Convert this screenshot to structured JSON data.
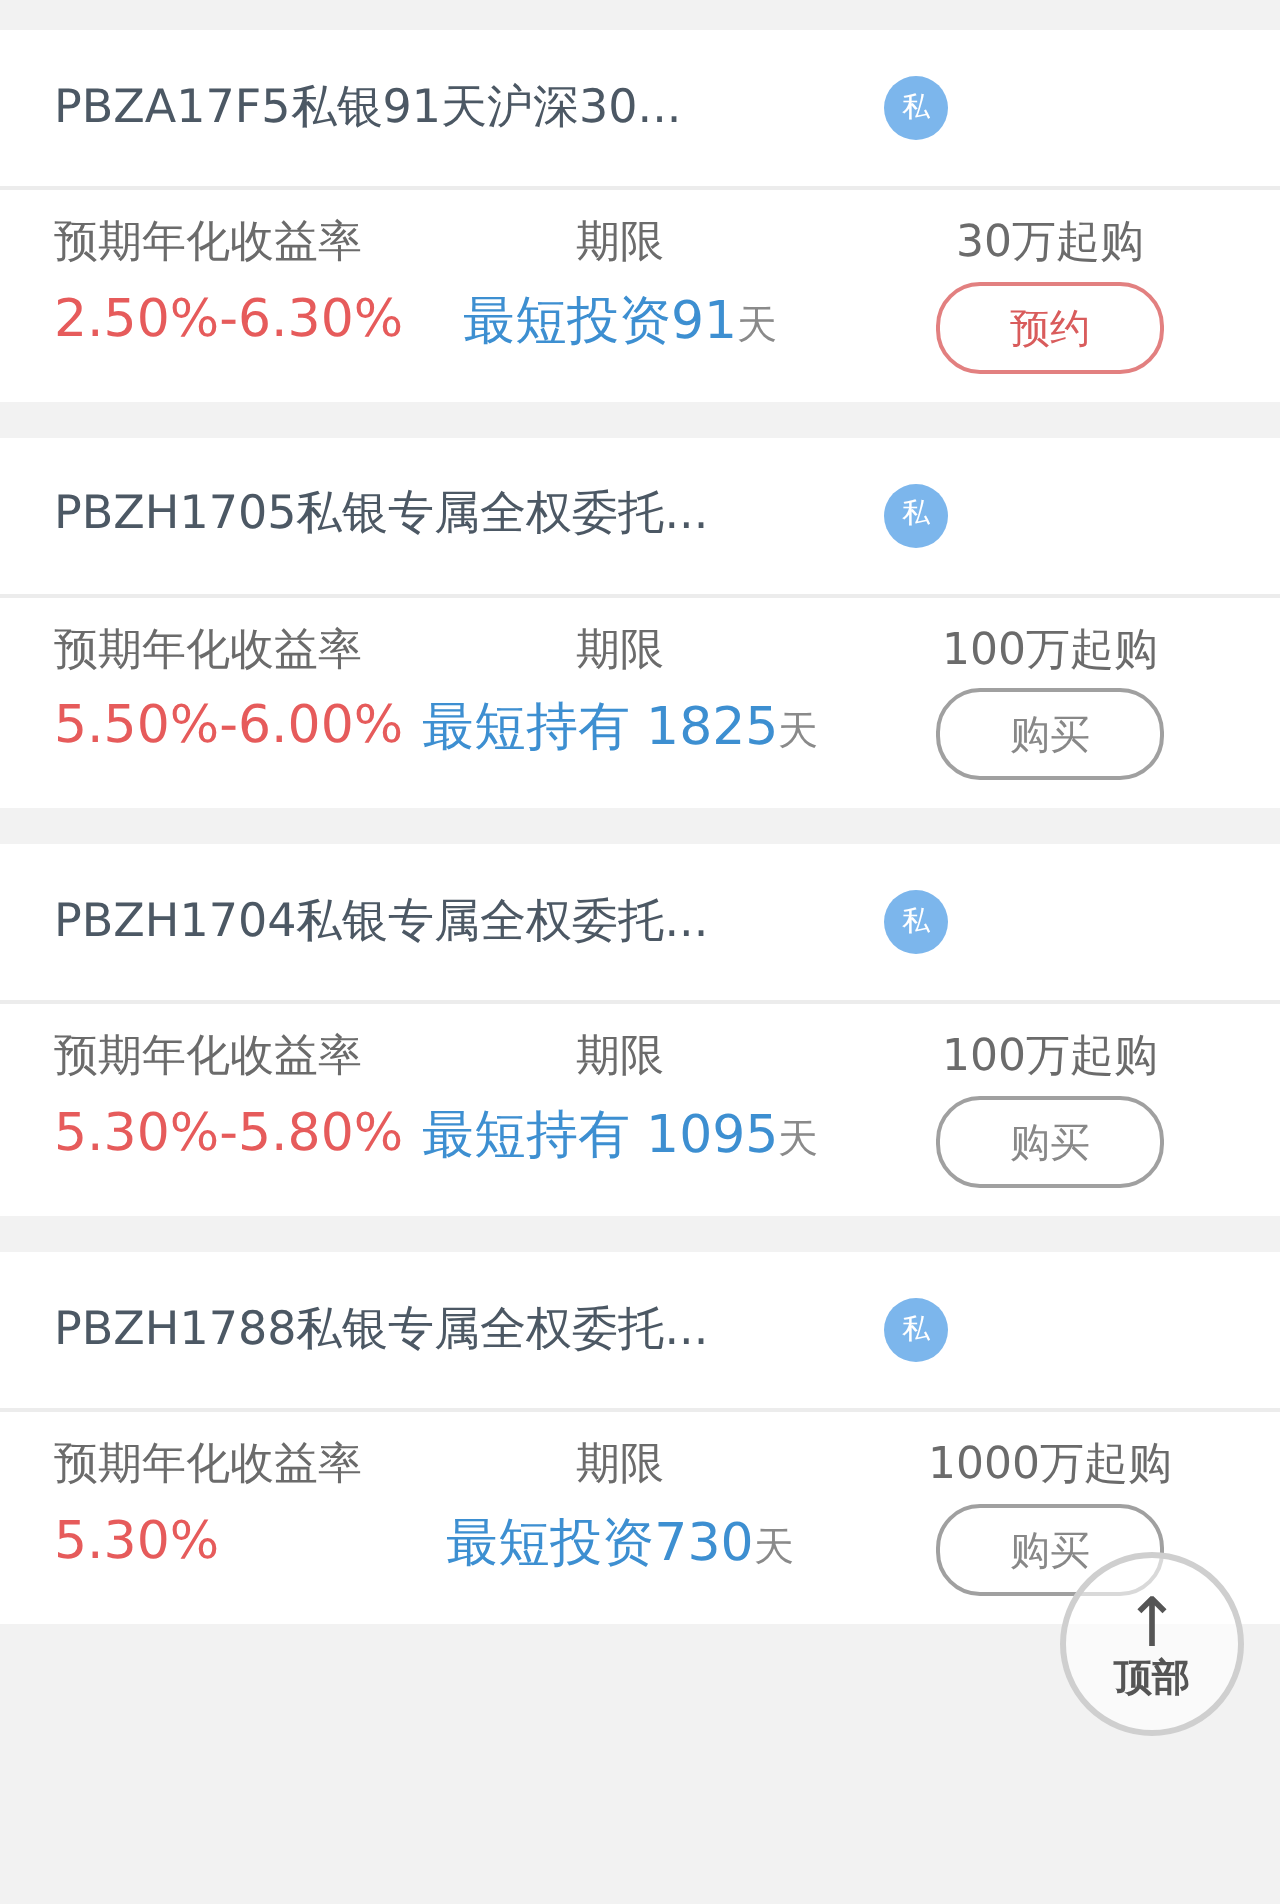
{
  "products": [
    {
      "title": "PBZA17F5私银91天沪深30...",
      "tag": "私",
      "rate_label": "预期年化收益率",
      "rate": "2.50%-6.30%",
      "term_label": "期限",
      "term_text": "最短投资91",
      "term_unit": "天",
      "min_amount": "30万起购",
      "button": {
        "kind": "reserve",
        "label": "预约"
      }
    },
    {
      "title": "PBZH1705私银专属全权委托...",
      "tag": "私",
      "rate_label": "预期年化收益率",
      "rate": "5.50%-6.00%",
      "term_text": "最短持有 1825",
      "term_unit": "天",
      "term_label": "期限",
      "min_amount": "100万起购",
      "button": {
        "kind": "buy",
        "label": "购买"
      }
    },
    {
      "title": "PBZH1704私银专属全权委托...",
      "tag": "私",
      "rate_label": "预期年化收益率",
      "rate": "5.30%-5.80%",
      "term_label": "期限",
      "term_text": "最短持有 1095",
      "term_unit": "天",
      "min_amount": "100万起购",
      "button": {
        "kind": "buy",
        "label": "购买"
      }
    },
    {
      "title": "PBZH1788私银专属全权委托...",
      "tag": "私",
      "rate_label": "预期年化收益率",
      "rate": "5.30%",
      "term_label": "期限",
      "term_text": "最短投资730",
      "term_unit": "天",
      "min_amount": "1000万起购",
      "button": {
        "kind": "buy",
        "label": "购买"
      }
    }
  ],
  "back_to_top": {
    "arrow": "↑",
    "label": "顶部"
  }
}
